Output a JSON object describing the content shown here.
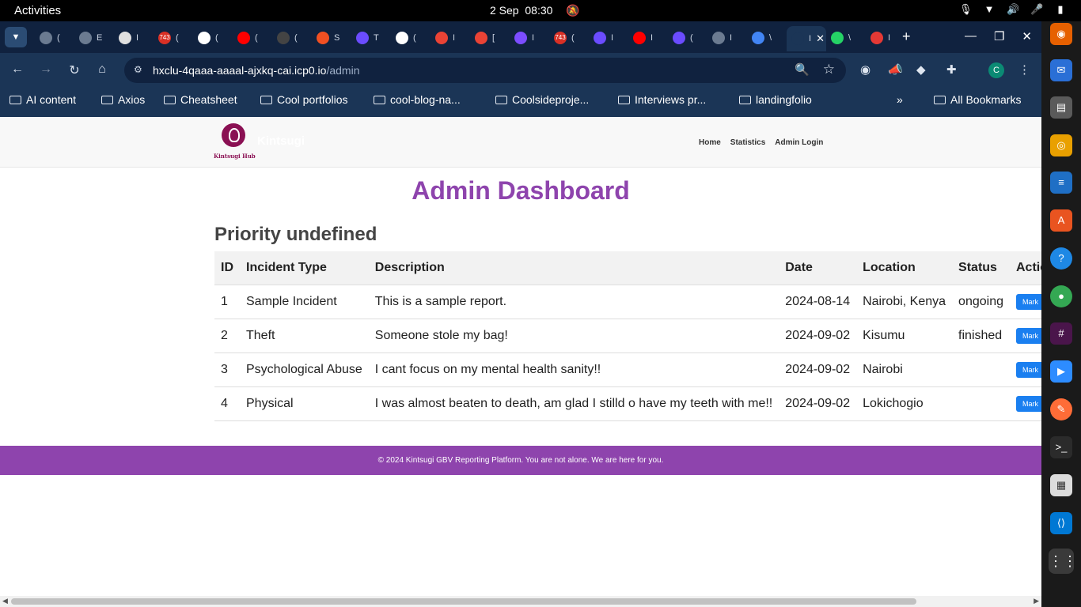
{
  "system": {
    "activities": "Activities",
    "date": "2 Sep",
    "time": "08:30"
  },
  "browser": {
    "tabs": [
      {
        "label": "(",
        "icon": "globe-icon",
        "color": "#6b7b91"
      },
      {
        "label": "E",
        "icon": "globe-icon",
        "color": "#6b7b91"
      },
      {
        "label": "I",
        "icon": "page-icon",
        "color": "#e0e0e0"
      },
      {
        "label": "(",
        "icon": "mail-counter-icon",
        "color": "#d93025",
        "badge": "743"
      },
      {
        "label": "(",
        "icon": "chatgpt-icon",
        "color": "#ffffff"
      },
      {
        "label": "(",
        "icon": "youtube-icon",
        "color": "#ff0000"
      },
      {
        "label": "(",
        "icon": "news-icon",
        "color": "#444444"
      },
      {
        "label": "S",
        "icon": "microsoft-icon",
        "color": "#f25022"
      },
      {
        "label": "T",
        "icon": "infinity-icon",
        "color": "#6b4cff"
      },
      {
        "label": "(",
        "icon": "github-icon",
        "color": "#ffffff"
      },
      {
        "label": "I",
        "icon": "gmail-icon",
        "color": "#ea4335"
      },
      {
        "label": "[",
        "icon": "gmail-icon",
        "color": "#ea4335"
      },
      {
        "label": "I",
        "icon": "app-icon",
        "color": "#7c4dff"
      },
      {
        "label": "(",
        "icon": "mail-counter-icon",
        "color": "#d93025",
        "badge": "743"
      },
      {
        "label": "I",
        "icon": "infinity-icon",
        "color": "#6b4cff"
      },
      {
        "label": "I",
        "icon": "youtube-icon",
        "color": "#ff0000"
      },
      {
        "label": "(",
        "icon": "infinity-icon",
        "color": "#6b4cff"
      },
      {
        "label": "I",
        "icon": "globe-icon",
        "color": "#6b7b91"
      },
      {
        "label": "\\",
        "icon": "google-icon",
        "color": "#4285f4"
      },
      {
        "label": "I",
        "icon": "active-tab",
        "color": "#1b3556",
        "active": true
      },
      {
        "label": "\\",
        "icon": "whatsapp-icon",
        "color": "#25d366"
      },
      {
        "label": "I",
        "icon": "speed-icon",
        "color": "#e53935"
      }
    ],
    "url_host": "hxclu-4qaaa-aaaal-ajxkq-cai.icp0.io",
    "url_path": "/admin",
    "profile_initial": "C",
    "bookmarks": [
      "AI content",
      "Axios",
      "Cheatsheet",
      "Cool portfolios",
      "cool-blog-na...",
      "Coolsideproje...",
      "Interviews pr...",
      "landingfolio"
    ],
    "all_bookmarks": "All Bookmarks"
  },
  "site": {
    "brand": "Kintsugi",
    "logo_caption": "Kintsugi Hub",
    "nav": [
      "Home",
      "Statistics",
      "Admin Login"
    ],
    "dashboard_title": "Admin Dashboard",
    "section_title": "Priority undefined",
    "table": {
      "headers": [
        "ID",
        "Incident Type",
        "Description",
        "Date",
        "Location",
        "Status",
        "Actio"
      ],
      "rows": [
        {
          "id": "1",
          "type": "Sample Incident",
          "description": "This is a sample report.",
          "date": "2024-08-14",
          "location": "Nairobi, Kenya",
          "status": "ongoing",
          "action": "Mark"
        },
        {
          "id": "2",
          "type": "Theft",
          "description": "Someone stole my bag!",
          "date": "2024-09-02",
          "location": "Kisumu",
          "status": "finished",
          "action": "Mark"
        },
        {
          "id": "3",
          "type": "Psychological Abuse",
          "description": "I cant focus on my mental health sanity!!",
          "date": "2024-09-02",
          "location": "Nairobi",
          "status": "",
          "action": "Mark"
        },
        {
          "id": "4",
          "type": "Physical",
          "description": "I was almost beaten to death, am glad I stilld o have my teeth with me!!",
          "date": "2024-09-02",
          "location": "Lokichogio",
          "status": "",
          "action": "Mark"
        }
      ]
    },
    "footer": "© 2024 Kintsugi GBV Reporting Platform. You are not alone. We are here for you."
  },
  "colors": {
    "accent": "#8e44ad",
    "button": "#1a7ff0",
    "logo": "#8a1053"
  }
}
